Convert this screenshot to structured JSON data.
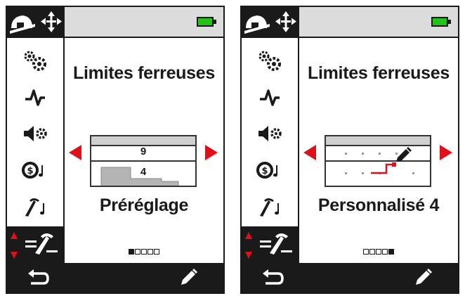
{
  "screens": [
    {
      "title": "Limites ferreuses",
      "mode_label": "Préréglage",
      "preset": {
        "upper_value": "9",
        "lower_value": "4"
      },
      "page_indicator": {
        "count": 5,
        "active_index": 0
      }
    },
    {
      "title": "Limites ferreuses",
      "mode_label": "Personnalisé 4",
      "page_indicator": {
        "count": 5,
        "active_index": 4
      }
    }
  ],
  "status": {
    "battery_color": "#22c21a"
  },
  "sidebar_icons": [
    "settings-gears-icon",
    "threshold-waveform-icon",
    "volume-settings-icon",
    "audio-tones-icon",
    "pick-tone-icon",
    "ferrous-limits-icon"
  ],
  "colors": {
    "accent_red": "#e0101a",
    "dark": "#1a1a1a",
    "battery": "#22c21a"
  }
}
